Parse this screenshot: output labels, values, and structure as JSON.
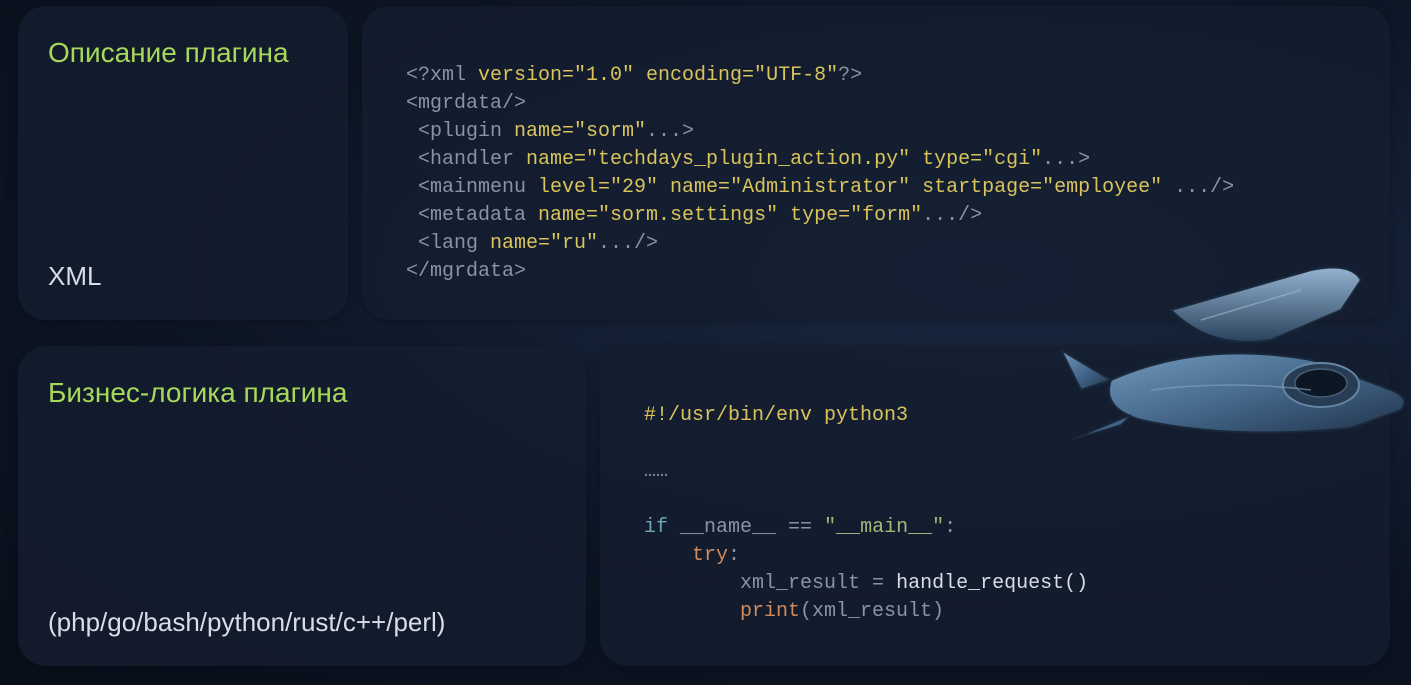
{
  "row1": {
    "label_title": "Описание плагина",
    "label_sub": "XML",
    "code": {
      "l1_a": "<?xml ",
      "l1_b": "version=\"1.0\" encoding=\"UTF-8\"",
      "l1_c": "?>",
      "l2": "<mgrdata/>",
      "l3_a": "<plugin ",
      "l3_b": "name=\"sorm\"",
      "l3_c": "...>",
      "l4_a": "<handler ",
      "l4_b": "name=\"techdays_plugin_action.py\" type=\"cgi\"",
      "l4_c": "...>",
      "l5_a": "<mainmenu ",
      "l5_b": "level=\"29\" name=\"Administrator\" startpage=\"employee\" ",
      "l5_c": ".../>",
      "l6_a": "<metadata ",
      "l6_b": "name=\"sorm.settings\" type=\"form\"",
      "l6_c": ".../>",
      "l7_a": "<lang ",
      "l7_b": "name=\"ru\"",
      "l7_c": ".../>",
      "l8": "</mgrdata>"
    }
  },
  "row2": {
    "label_title": "Бизнес-логика плагина",
    "label_sub": "(php/go/bash/python/rust/c++/perl)",
    "code": {
      "l1": "#!/usr/bin/env python3",
      "l2": "……",
      "l3_a": "if",
      "l3_b": " __name__ ",
      "l3_c": "==",
      "l3_d": " \"__main__\"",
      "l3_e": ":",
      "l4_a": "try",
      "l4_b": ":",
      "l5_a": "xml_result ",
      "l5_b": "=",
      "l5_c": " handle_request()",
      "l6_a": "print",
      "l6_b": "(xml_result)"
    }
  }
}
